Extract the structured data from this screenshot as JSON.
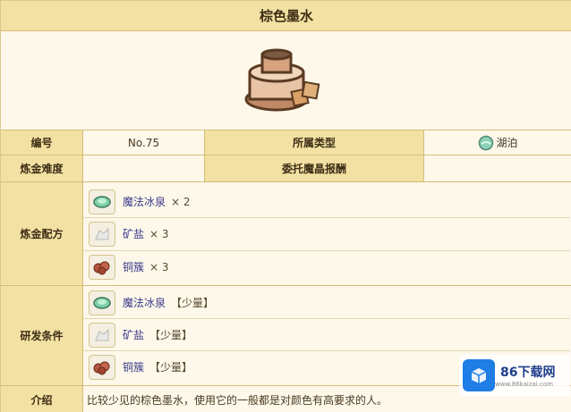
{
  "title": "棕色墨水",
  "colors": {
    "header_bg": "#f3e1a3",
    "label_bg": "#f3e1a3",
    "value_bg": "#fdf8ea",
    "border": "#d4bd7a",
    "item_link": "#3b3a8a"
  },
  "info": {
    "number_label": "编号",
    "number_value": "No.75",
    "type_label": "所属类型",
    "type_value": "湖泊",
    "type_icon": "lake-icon",
    "difficulty_label": "炼金难度",
    "difficulty_value": "",
    "reward_label": "委托魔晶报酬",
    "reward_value": ""
  },
  "recipe": {
    "label": "炼金配方",
    "items": [
      {
        "name": "魔法冰泉",
        "qty": "× 2",
        "icon": "magic-spring-icon"
      },
      {
        "name": "矿盐",
        "qty": "× 3",
        "icon": "rock-salt-icon"
      },
      {
        "name": "铜簇",
        "qty": "× 3",
        "icon": "copper-cluster-icon"
      }
    ]
  },
  "research": {
    "label": "研发条件",
    "items": [
      {
        "name": "魔法冰泉",
        "qty": "【少量】",
        "icon": "magic-spring-icon"
      },
      {
        "name": "矿盐",
        "qty": "【少量】",
        "icon": "rock-salt-icon"
      },
      {
        "name": "铜簇",
        "qty": "【少量】",
        "icon": "copper-cluster-icon"
      }
    ]
  },
  "intro": {
    "label": "介绍",
    "text": "比较少见的棕色墨水，使用它的一般都是对颜色有高要求的人。"
  },
  "watermark": {
    "text": "86下载网",
    "sub": "www.86kaizai.com"
  }
}
